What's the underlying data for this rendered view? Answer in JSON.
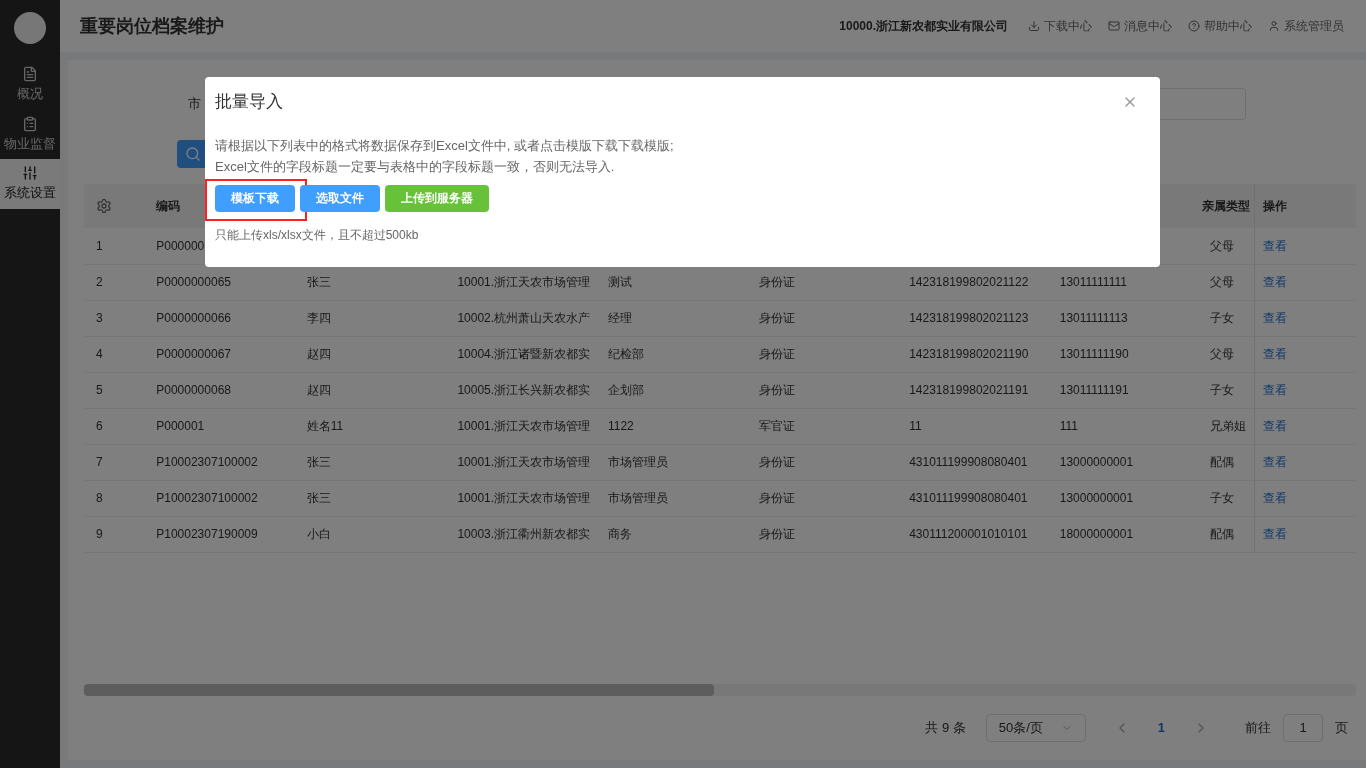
{
  "sidebar": {
    "items": [
      {
        "label": "概况",
        "selected": false
      },
      {
        "label": "物业监督",
        "selected": false
      },
      {
        "label": "系统设置",
        "selected": true
      }
    ]
  },
  "header": {
    "title": "重要岗位档案维护",
    "company": "10000.浙江新农都实业有限公司",
    "links": [
      {
        "label": "下载中心"
      },
      {
        "label": "消息中心"
      },
      {
        "label": "帮助中心"
      },
      {
        "label": "系统管理员"
      }
    ]
  },
  "filter": {
    "label": "市"
  },
  "table": {
    "columns": [
      "",
      "编码",
      "",
      "",
      "",
      "",
      "",
      "",
      "亲属类型",
      "操作"
    ],
    "rows": [
      [
        "1",
        "P000000",
        "",
        "",
        "",
        "",
        "",
        "",
        "父母",
        "查看"
      ],
      [
        "2",
        "P0000000065",
        "张三",
        "10001.浙江天农市场管理",
        "测试",
        "身份证",
        "142318199802021122",
        "13011111111",
        "父母",
        "查看"
      ],
      [
        "3",
        "P0000000066",
        "李四",
        "10002.杭州萧山天农水产",
        "经理",
        "身份证",
        "142318199802021123",
        "13011111113",
        "子女",
        "查看"
      ],
      [
        "4",
        "P0000000067",
        "赵四",
        "10004.浙江诸暨新农都实",
        "纪检部",
        "身份证",
        "142318199802021190",
        "13011111190",
        "父母",
        "查看"
      ],
      [
        "5",
        "P0000000068",
        "赵四",
        "10005.浙江长兴新农都实",
        "企划部",
        "身份证",
        "142318199802021191",
        "13011111191",
        "子女",
        "查看"
      ],
      [
        "6",
        "P000001",
        "姓名11",
        "10001.浙江天农市场管理",
        "1122",
        "军官证",
        "11",
        "111",
        "兄弟姐",
        "查看"
      ],
      [
        "7",
        "P10002307100002",
        "张三",
        "10001.浙江天农市场管理",
        "市场管理员",
        "身份证",
        "431011199908080401",
        "13000000001",
        "配偶",
        "查看"
      ],
      [
        "8",
        "P10002307100002",
        "张三",
        "10001.浙江天农市场管理",
        "市场管理员",
        "身份证",
        "431011199908080401",
        "13000000001",
        "子女",
        "查看"
      ],
      [
        "9",
        "P10002307190009",
        "小白",
        "10003.浙江衢州新农都实",
        "商务",
        "身份证",
        "430111200001010101",
        "18000000001",
        "配偶",
        "查看"
      ]
    ]
  },
  "pagination": {
    "total": "共 9 条",
    "page_size": "50条/页",
    "pages": [
      {
        "label": "1",
        "selected": true
      }
    ],
    "goto_label": "前往",
    "goto_value": "1",
    "page_suffix": "页"
  },
  "dialog": {
    "title": "批量导入",
    "lines": [
      "请根据以下列表中的格式将数据保存到Excel文件中, 或者点击模版下载下载模版;",
      "Excel文件的字段标题一定要与表格中的字段标题一致，否则无法导入."
    ],
    "buttons": [
      {
        "label": "模板下载",
        "kind": "blue",
        "highlighted": true
      },
      {
        "label": "选取文件",
        "kind": "blue",
        "highlighted": false
      },
      {
        "label": "上传到服务器",
        "kind": "green",
        "highlighted": false
      }
    ],
    "note": "只能上传xls/xlsx文件，且不超过500kb"
  }
}
